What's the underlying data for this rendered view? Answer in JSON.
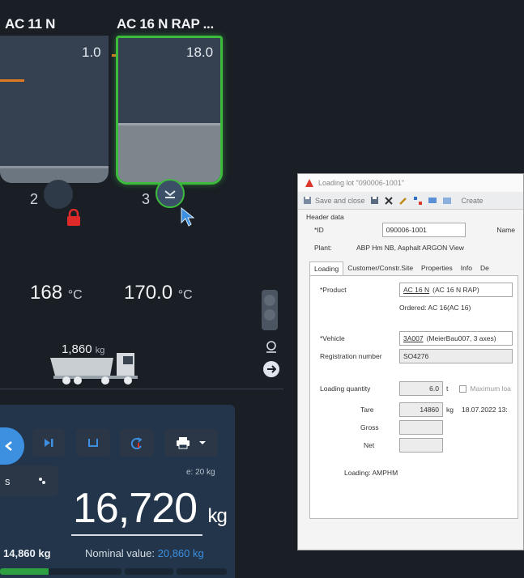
{
  "silos": [
    {
      "name": "AC 11 N",
      "fill": "1.0",
      "number": "2"
    },
    {
      "name": "AC 16 N RAP ...",
      "fill": "18.0",
      "number": "3"
    }
  ],
  "temperatures": [
    {
      "value": "168",
      "unit": "°C"
    },
    {
      "value": "170.0",
      "unit": "°C"
    }
  ],
  "truck": {
    "weight": "1,860",
    "unit": "kg"
  },
  "scale": {
    "increment": "e: 20 kg",
    "weight": "16,720",
    "unit": "kg",
    "left_value": "14,860 kg",
    "nominal_label": "Nominal value:",
    "nominal_value": "20,860 kg",
    "left_button_label": "s"
  },
  "colors": {
    "accent_green": "#3dbb3d",
    "accent_blue": "#3d8fe0",
    "lock_red": "#e02a2a",
    "orange": "#e07a22"
  },
  "dialog": {
    "title": "Loading lot \"090006-1001\"",
    "toolbar": {
      "save_close": "Save and close",
      "create": "Create"
    },
    "header_section": "Header data",
    "id_label": "*ID",
    "id_value": "090006-1001",
    "name_label": "Name",
    "plant_label": "Plant:",
    "plant_value": "ABP Hm NB, Asphalt ARGON View",
    "tabs": [
      "Loading",
      "Customer/Constr.Site",
      "Properties",
      "Info",
      "De"
    ],
    "product_label": "*Product",
    "product_code": "AC 16 N",
    "product_name": "(AC 16 N RAP)",
    "ordered": "Ordered: AC 16(AC 16)",
    "vehicle_label": "*Vehicle",
    "vehicle_code": "3A007",
    "vehicle_name": "(MeierBau007, 3 axes)",
    "registration_label": "Registration number",
    "registration_value": "SO4276",
    "loading_qty_label": "Loading quantity",
    "loading_qty_value": "6.0",
    "loading_qty_unit": "t",
    "max_load_label": "Maximum loa",
    "tare_label": "Tare",
    "tare_value": "14860",
    "tare_unit": "kg",
    "tare_date": "18.07.2022 13:",
    "gross_label": "Gross",
    "net_label": "Net",
    "loading_status": "Loading: AMPHM"
  }
}
